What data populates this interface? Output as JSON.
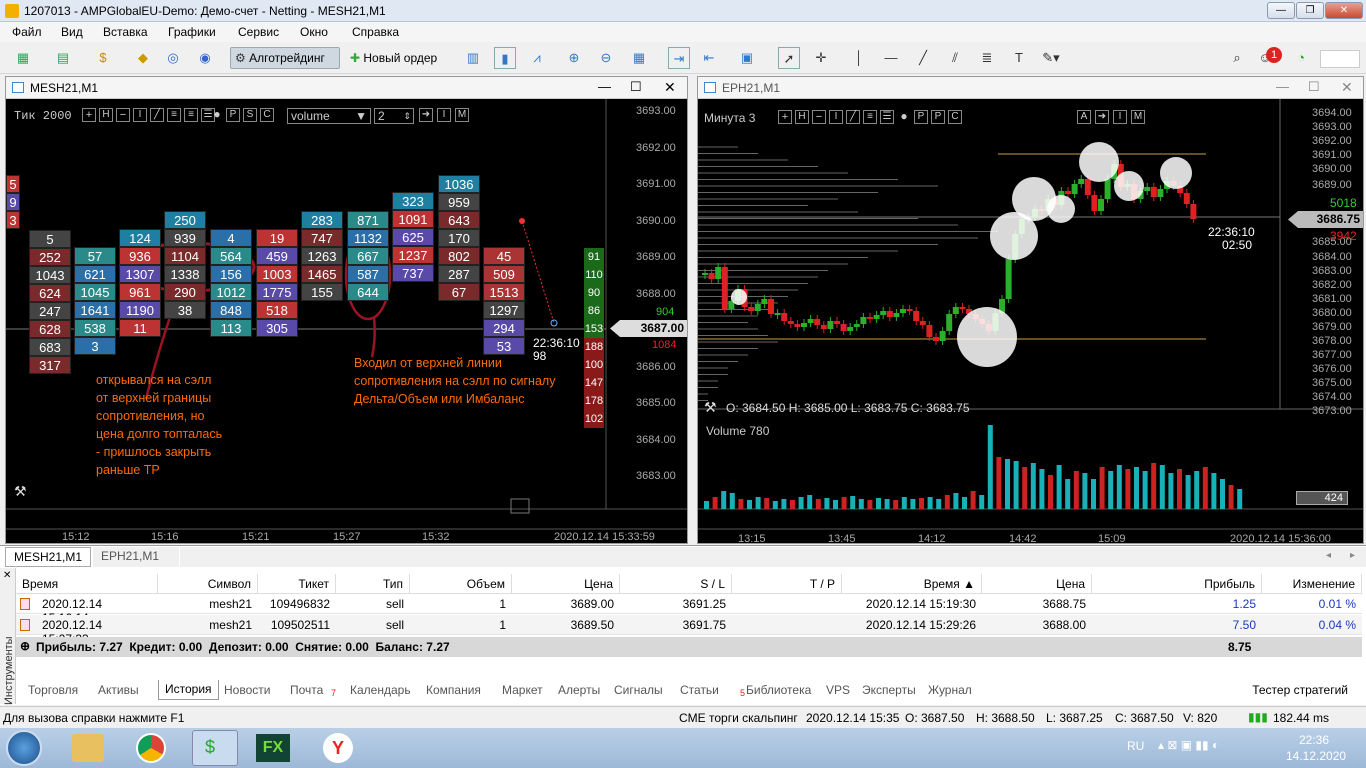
{
  "window": {
    "title": "1207013 - AMPGlobalEU-Demo: Демо-счет - Netting - MESH21,M1"
  },
  "menu": [
    "Файл",
    "Вид",
    "Вставка",
    "Графики",
    "Сервис",
    "Окно",
    "Справка"
  ],
  "toolbar": {
    "algo": "Алготрейдинг",
    "new_order": "Новый ордер",
    "badge": "1"
  },
  "left_chart": {
    "title": "MESH21,M1",
    "tick_label": "Тик  2000",
    "tool_letters": [
      "H",
      "I",
      "P",
      "S",
      "C"
    ],
    "volume_select": "volume",
    "depth_value": "2",
    "times": [
      "15:12",
      "15:16",
      "15:21",
      "15:27",
      "15:32"
    ],
    "date_label": "2020.12.14 15:33:59",
    "prices": [
      "3693.00",
      "3692.00",
      "3691.00",
      "3690.00",
      "3689.00",
      "3688.00",
      "3687.00",
      "3686.00",
      "3685.00",
      "3684.00",
      "3683.00"
    ],
    "current_price": "3687.00",
    "ask_small": "904",
    "bid_small": "1084",
    "timer": "22:36:10",
    "timer2": "98",
    "bid_ladder": [
      "91",
      "110",
      "90",
      "86",
      "153",
      "188",
      "100",
      "147",
      "178",
      "102"
    ],
    "annotation1": [
      "открывался на сэлл",
      "от верхней границы",
      "сопротивления, но",
      "цена долго топталась",
      "- пришлось закрыть",
      "раньше TP"
    ],
    "annotation2": [
      "Входил от верхней линии",
      "сопротивления на сэлл по сигналу",
      "Дельта/Объем или Имбаланс"
    ],
    "columns": [
      {
        "cells": [
          "5",
          "9",
          "3"
        ]
      },
      {
        "cells": [
          "5",
          "252",
          "1043",
          "624",
          "247",
          "628",
          "683",
          "317"
        ]
      },
      {
        "cells": [
          "57",
          "621",
          "1045",
          "1641",
          "538",
          "3"
        ]
      },
      {
        "cells": [
          "124",
          "936",
          "1307",
          "961",
          "1190",
          "11"
        ]
      },
      {
        "cells": [
          "250",
          "939",
          "1104",
          "1338",
          "290",
          "38"
        ]
      },
      {
        "cells": [
          "4",
          "564",
          "156",
          "1012",
          "848",
          "113"
        ]
      },
      {
        "cells": [
          "19",
          "459",
          "1003",
          "1775",
          "518",
          "305"
        ]
      },
      {
        "cells": [
          "283",
          "747",
          "1263",
          "1465",
          "155"
        ]
      },
      {
        "cells": [
          "871",
          "1132",
          "667",
          "587",
          "644"
        ]
      },
      {
        "cells": [
          "323",
          "1091",
          "625",
          "1237",
          "737"
        ]
      },
      {
        "cells": [
          "1036",
          "959",
          "643",
          "170",
          "802",
          "287",
          "67"
        ]
      },
      {
        "cells": [
          "45",
          "509",
          "1513",
          "1297",
          "294",
          "53"
        ]
      }
    ]
  },
  "right_chart": {
    "title": "EPH21,M1",
    "label": "Минута  3",
    "tool_letters": [
      "H",
      "I",
      "P",
      "C"
    ],
    "tool_letters_right": [
      "A",
      "I",
      "M"
    ],
    "ohlc": "O: 3684.50  H: 3685.00  L: 3683.75  C: 3683.75",
    "prices": [
      "3694.00",
      "3693.00",
      "3692.00",
      "3691.00",
      "3690.00",
      "3689.00",
      "3685.00",
      "3684.00",
      "3683.00",
      "3682.00",
      "3681.00",
      "3680.00",
      "3679.00",
      "3678.00",
      "3677.00",
      "3676.00",
      "3675.00",
      "3674.00",
      "3673.00"
    ],
    "current_price": "3686.75",
    "green_vol": "5018",
    "red_vol": "3942",
    "timer": "22:36:10",
    "timer2": "02:50",
    "volume_label": "Volume 780",
    "volume_value": "424",
    "times": [
      "13:15",
      "13:45",
      "14:12",
      "14:42",
      "15:09"
    ],
    "date_label": "2020.12.14 15:36:00"
  },
  "chart_tabs": [
    "MESH21,M1",
    "EPH21,M1"
  ],
  "terminal": {
    "side_label": "Инструменты",
    "headers": [
      "Время",
      "Символ",
      "Тикет",
      "Тип",
      "Объем",
      "Цена",
      "S / L",
      "T / P",
      "Время",
      "Цена",
      "Прибыль",
      "Изменение"
    ],
    "rows": [
      [
        "2020.12.14 15:16:14",
        "mesh21",
        "109496832",
        "sell",
        "1",
        "3689.00",
        "3691.25",
        "",
        "2020.12.14 15:19:30",
        "3688.75",
        "1.25",
        "0.01 %"
      ],
      [
        "2020.12.14 15:27:33",
        "mesh21",
        "109502511",
        "sell",
        "1",
        "3689.50",
        "3691.75",
        "",
        "2020.12.14 15:29:26",
        "3688.00",
        "7.50",
        "0.04 %"
      ]
    ],
    "summary": "Прибыль: 7.27  Кредит: 0.00  Депозит: 0.00  Снятие: 0.00  Баланс: 7.27",
    "summary_total": "8.75",
    "tabs": [
      "Торговля",
      "Активы",
      "История",
      "Новости",
      "Почта",
      "Календарь",
      "Компания",
      "Маркет",
      "Алерты",
      "Сигналы",
      "Статьи",
      "Библиотека",
      "VPS",
      "Эксперты",
      "Журнал"
    ],
    "mail_count": "7",
    "articles_count": "5",
    "tester": "Тестер стратегий"
  },
  "status": {
    "help": "Для вызова справки нажмите F1",
    "profile": "CME торги скальпинг",
    "time": "2020.12.14 15:35",
    "o": "O: 3687.50",
    "h": "H: 3688.50",
    "l": "L: 3687.25",
    "c": "C: 3687.50",
    "v": "V: 820",
    "ping": "182.44 ms"
  },
  "taskbar": {
    "lang": "RU",
    "time": "22:36",
    "date": "14.12.2020"
  }
}
